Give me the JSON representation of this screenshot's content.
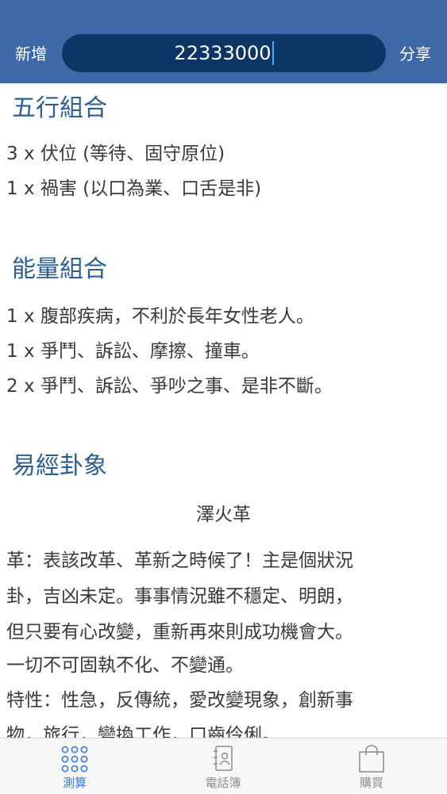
{
  "header": {
    "add_label": "新增",
    "share_label": "分享",
    "search_value": "22333000"
  },
  "sections": {
    "wuxing": {
      "title": "五行組合",
      "lines": [
        "3 x 伏位 (等待、固守原位)",
        "1 x 禍害 (以口為業、口舌是非)"
      ]
    },
    "energy": {
      "title": "能量組合",
      "lines": [
        "1 x 腹部疾病，不利於長年女性老人。",
        "1 x 爭鬥、訴訟、摩擦、撞車。",
        "2 x 爭鬥、訴訟、爭吵之事、是非不斷。"
      ]
    },
    "yijing": {
      "title": "易經卦象",
      "gua_name": "澤火革",
      "lines": [
        "革：表該改革、革新之時候了！主是個狀況",
        "卦，吉凶未定。事事情況雖不穩定、明朗，",
        "但只要有心改變，重新再來則成功機會大。",
        "一切不可固執不化、不變通。",
        "特性：性急，反傳統，愛改變現象，創新事",
        "物，旅行，變換工作，口齒伶俐。"
      ]
    }
  },
  "tabs": [
    {
      "label": "測算",
      "icon": "grid-icon",
      "active": true
    },
    {
      "label": "電話簿",
      "icon": "contacts-book-icon",
      "active": false
    },
    {
      "label": "購買",
      "icon": "shopping-bag-icon",
      "active": false
    }
  ],
  "colors": {
    "header": "#3e69a8",
    "search_bg": "#0d3566",
    "section_title": "#2c5e94",
    "tab_active": "#3b7ad6",
    "tab_inactive": "#8e8e93"
  }
}
